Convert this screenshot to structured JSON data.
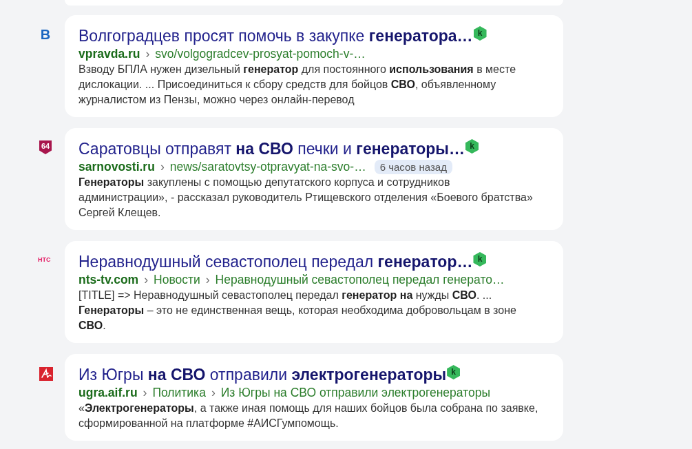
{
  "results": [
    {
      "favicon": {
        "kind": "letter",
        "text": "В"
      },
      "title": "Волгоградцев просят помочь в закупке **генератора…**",
      "badge": "k",
      "domain": "vpravda.ru",
      "path": [
        {
          "separator": "›",
          "text": "svo/volgogradcev-prosyat-pomoch-v-…"
        }
      ],
      "snippet": "Взводу БПЛА нужен дизельный **генератор** для постоянного **использования** в месте дислокации. ... Присоединиться к сбору средств для бойцов **СВО**, объявленному журналистом из Пензы, можно через онлайн-перевод"
    },
    {
      "favicon": {
        "kind": "shield",
        "text": "64"
      },
      "title": "Саратовцы отправят **на СВО** печки и **генераторы…**",
      "badge": "k",
      "domain": "sarnovosti.ru",
      "path": [
        {
          "separator": "›",
          "text": "news/saratovtsy-otpravyat-na-svo-…"
        }
      ],
      "time": "6 часов назад",
      "snippet": "**Генераторы** закуплены с помощью депутатского корпуса и сотрудников администрации», - рассказал руководитель Ртищевского отделения «Боевого братства» Сергей Клещев."
    },
    {
      "favicon": {
        "kind": "wordmark",
        "text": "НТС"
      },
      "title": "Неравнодушный севастополец передал **генератор…**",
      "badge": "k",
      "domain": "nts-tv.com",
      "path": [
        {
          "separator": "›",
          "text": "Новости"
        },
        {
          "separator": "›",
          "text": "Неравнодушный севастополец передал генерато…"
        }
      ],
      "snippet": "[TITLE] => Неравнодушный севастополец передал **генератор на** нужды **СВО**. ... **Генераторы** – это не единственная вещь, которая необходима добровольцам в зоне **СВО**."
    },
    {
      "favicon": {
        "kind": "logo"
      },
      "title": "Из Югры **на СВО** отправили **электрогенераторы**",
      "badge": "k",
      "domain": "ugra.aif.ru",
      "path": [
        {
          "separator": "›",
          "text": "Политика"
        },
        {
          "separator": "›",
          "text": "Из Югры на СВО отправили электрогенераторы"
        }
      ],
      "snippet": "«**Электрогенераторы**, а также иная помощь для наших бойцов была собрана по заявке, сформированной на платформе #АИСГумпомощь."
    }
  ]
}
